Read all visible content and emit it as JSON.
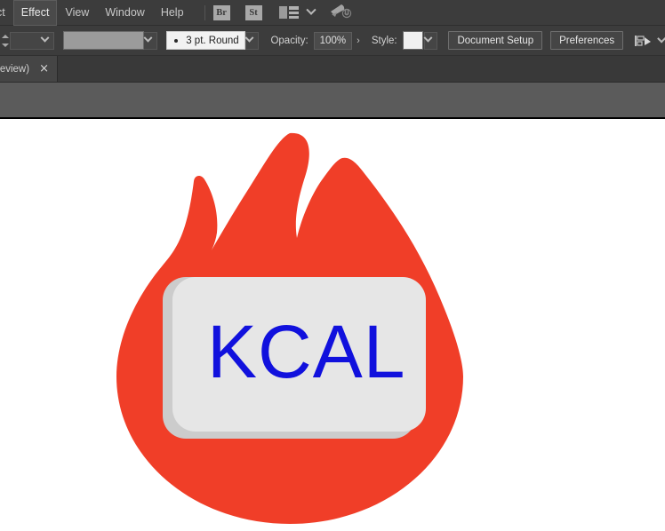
{
  "app": {
    "theme_bg": "#3c3c3c",
    "canvas_bg": "#ffffff"
  },
  "menubar": {
    "items": [
      {
        "label": "ct",
        "active": false
      },
      {
        "label": "Effect",
        "active": true
      },
      {
        "label": "View",
        "active": false
      },
      {
        "label": "Window",
        "active": false
      },
      {
        "label": "Help",
        "active": false
      }
    ],
    "app_chips": [
      {
        "label": "Br",
        "name": "bridge-icon"
      },
      {
        "label": "St",
        "name": "stock-icon"
      }
    ],
    "workspace_icon": "workspace-layout-icon",
    "workspace_chevron": "chevron-down-icon",
    "rocket_icon": "rocket-power-icon"
  },
  "controlbar": {
    "stepper": "stepper-arrows-icon",
    "fill_dropdown_value": "",
    "stroke_swatch_value": "",
    "stroke_profile": "3 pt. Round",
    "stroke_profile_dot": "round-cap-icon",
    "opacity_label": "Opacity:",
    "opacity_value": "100%",
    "opacity_next_arrow": "›",
    "style_label": "Style:",
    "style_swatch_value": "",
    "document_setup_label": "Document Setup",
    "preferences_label": "Preferences",
    "align_icon": "align-objects-icon",
    "align_chevron": "chevron-down-icon"
  },
  "tabstrip": {
    "tabs": [
      {
        "label": "review)",
        "close": "×"
      }
    ]
  },
  "artwork": {
    "name": "kcal-flame-logo",
    "flame_color": "#F03E28",
    "plate_shadow_color": "#cccccc",
    "plate_face_color": "#e6e6e6",
    "text": "KCAL",
    "text_color": "#1111dd",
    "text_font_size": 84
  }
}
